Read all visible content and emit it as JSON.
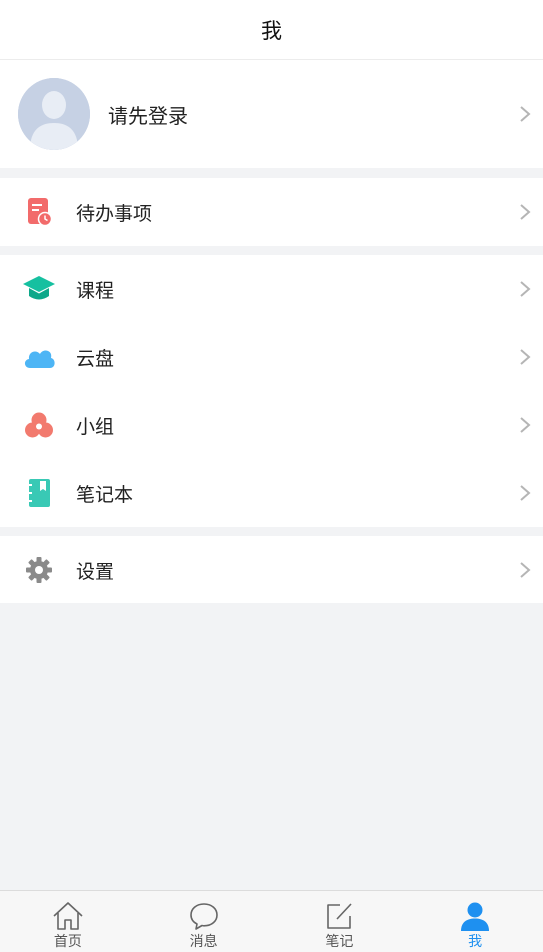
{
  "header": {
    "title": "我"
  },
  "profile": {
    "login_text": "请先登录"
  },
  "menu": {
    "todo": "待办事项",
    "items": [
      "课程",
      "云盘",
      "小组",
      "笔记本"
    ],
    "settings": "设置"
  },
  "tabbar": {
    "tabs": [
      {
        "label": "首页",
        "icon": "home-icon"
      },
      {
        "label": "消息",
        "icon": "chat-bubble-icon"
      },
      {
        "label": "笔记",
        "icon": "edit-note-icon"
      },
      {
        "label": "我",
        "icon": "user-icon",
        "active": true
      }
    ]
  },
  "colors": {
    "accent": "#1e90f0",
    "todo_icon": "#f26b6b",
    "course_icon": "#16c0a0",
    "cloud_icon": "#4db5f5",
    "group_icon": "#f27a6e",
    "notebook_icon": "#39c9b5",
    "settings_icon": "#8a8a8a"
  }
}
